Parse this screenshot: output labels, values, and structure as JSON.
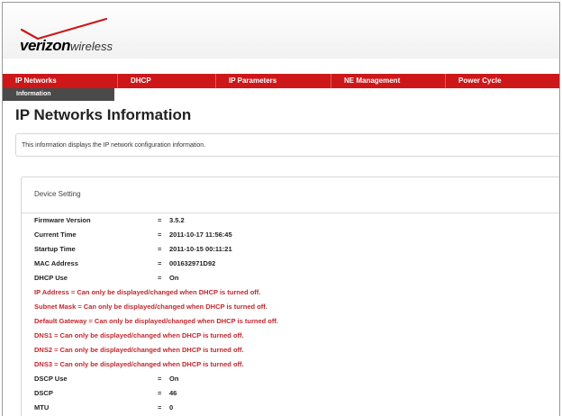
{
  "brand": {
    "name_prefix": "veri",
    "name_zon": "zon",
    "name_suffix": "wireless",
    "accent_color": "#cd1719"
  },
  "nav": {
    "items": [
      {
        "label": "IP Networks"
      },
      {
        "label": "DHCP"
      },
      {
        "label": "IP Parameters"
      },
      {
        "label": "NE Management"
      },
      {
        "label": "Power Cycle"
      }
    ]
  },
  "subnav": {
    "items": [
      {
        "label": "Information"
      }
    ]
  },
  "page": {
    "title": "IP Networks Information",
    "info": "This information displays the IP network configuration information."
  },
  "device_setting": {
    "title": "Device Setting",
    "rows_top": [
      {
        "label": "Firmware Version",
        "eq": "=",
        "value": "3.5.2"
      },
      {
        "label": "Current Time",
        "eq": "=",
        "value": "2011-10-17 11:56:45"
      },
      {
        "label": "Startup Time",
        "eq": "=",
        "value": "2011-10-15 00:11:21"
      },
      {
        "label": "MAC Address",
        "eq": "=",
        "value": "001632971D92"
      },
      {
        "label": "DHCP Use",
        "eq": "=",
        "value": "On"
      }
    ],
    "warnings": [
      "IP Address = Can only be displayed/changed when DHCP is turned off.",
      "Subnet Mask = Can only be displayed/changed when DHCP is turned off.",
      "Default Gateway = Can only be displayed/changed when DHCP is turned off.",
      "DNS1 = Can only be displayed/changed when DHCP is turned off.",
      "DNS2 = Can only be displayed/changed when DHCP is turned off.",
      "DNS3 = Can only be displayed/changed when DHCP is turned off."
    ],
    "rows_bottom": [
      {
        "label": "DSCP Use",
        "eq": "=",
        "value": "On"
      },
      {
        "label": "DSCP",
        "eq": "=",
        "value": "46"
      },
      {
        "label": "MTU",
        "eq": "=",
        "value": "0"
      }
    ]
  }
}
